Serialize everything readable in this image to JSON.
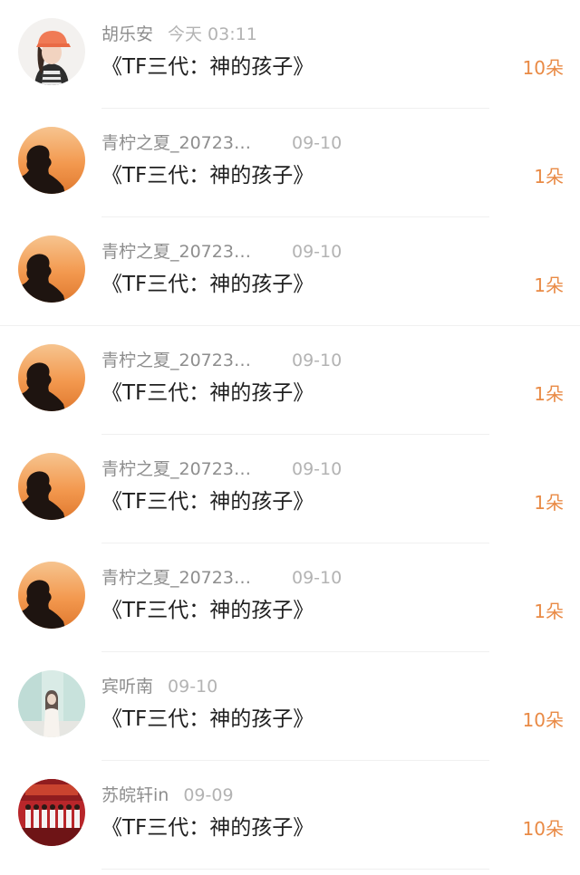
{
  "gift_records": [
    {
      "username": "胡乐安",
      "time": "今天 03:11",
      "gift_title": "《TF三代：神的孩子》",
      "amount": "10朵",
      "avatar": "girl-orange-cap-avatar"
    },
    {
      "username": "青柠之夏_20723…",
      "time": "09-10",
      "gift_title": "《TF三代：神的孩子》",
      "amount": "1朵",
      "avatar": "sunset-silhouette-avatar"
    },
    {
      "username": "青柠之夏_20723…",
      "time": "09-10",
      "gift_title": "《TF三代：神的孩子》",
      "amount": "1朵",
      "avatar": "sunset-silhouette-avatar"
    },
    {
      "username": "青柠之夏_20723…",
      "time": "09-10",
      "gift_title": "《TF三代：神的孩子》",
      "amount": "1朵",
      "avatar": "sunset-silhouette-avatar"
    },
    {
      "username": "青柠之夏_20723…",
      "time": "09-10",
      "gift_title": "《TF三代：神的孩子》",
      "amount": "1朵",
      "avatar": "sunset-silhouette-avatar"
    },
    {
      "username": "青柠之夏_20723…",
      "time": "09-10",
      "gift_title": "《TF三代：神的孩子》",
      "amount": "1朵",
      "avatar": "sunset-silhouette-avatar"
    },
    {
      "username": "宾听南",
      "time": "09-10",
      "gift_title": "《TF三代：神的孩子》",
      "amount": "10朵",
      "avatar": "girl-white-dress-avatar"
    },
    {
      "username": "苏皖轩in",
      "time": "09-09",
      "gift_title": "《TF三代：神的孩子》",
      "amount": "10朵",
      "avatar": "stage-group-avatar"
    }
  ],
  "colors": {
    "amount": "#e98a45",
    "username": "#8e8e8e",
    "time": "#b3b3b3",
    "title": "#1f1f1f",
    "divider": "#f0f0f0"
  }
}
